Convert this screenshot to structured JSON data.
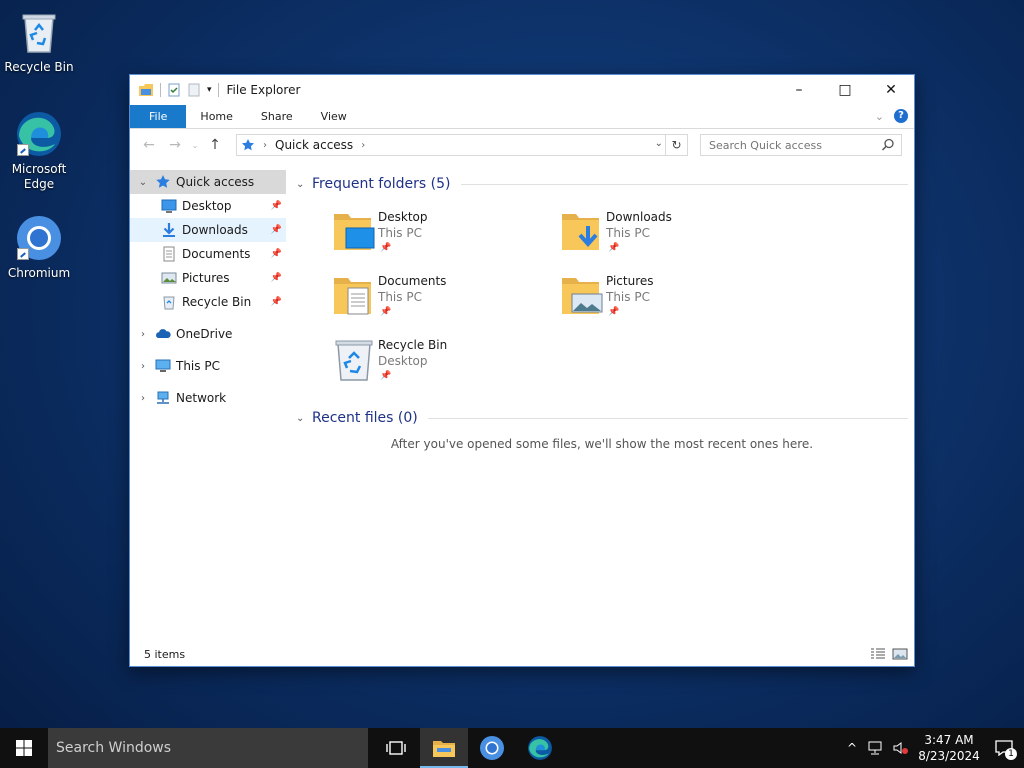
{
  "desktop": {
    "icons": [
      {
        "label": "Recycle Bin"
      },
      {
        "label": "Microsoft Edge"
      },
      {
        "label": "Chromium"
      }
    ]
  },
  "window": {
    "title": "File Explorer",
    "controls": {
      "minimize": "–",
      "maximize": "□",
      "close": "✕"
    },
    "ribbon_tabs": [
      "File",
      "Home",
      "Share",
      "View"
    ],
    "address": {
      "crumb": "Quick access"
    },
    "search": {
      "placeholder": "Search Quick access"
    },
    "nav": {
      "quick_access": "Quick access",
      "quick_items": [
        "Desktop",
        "Downloads",
        "Documents",
        "Pictures",
        "Recycle Bin"
      ],
      "onedrive": "OneDrive",
      "this_pc": "This PC",
      "network": "Network"
    },
    "frequent": {
      "header": "Frequent folders (5)",
      "tiles": [
        {
          "name": "Desktop",
          "sub": "This PC"
        },
        {
          "name": "Downloads",
          "sub": "This PC"
        },
        {
          "name": "Documents",
          "sub": "This PC"
        },
        {
          "name": "Pictures",
          "sub": "This PC"
        },
        {
          "name": "Recycle Bin",
          "sub": "Desktop"
        }
      ]
    },
    "recent": {
      "header": "Recent files (0)",
      "empty": "After you've opened some files, we'll show the most recent ones here."
    },
    "status": "5 items"
  },
  "taskbar": {
    "search_placeholder": "Search Windows",
    "time": "3:47 AM",
    "date": "8/23/2024",
    "notif_count": "1"
  },
  "colors": {
    "accent": "#1979ca",
    "folder": "#f8c75a",
    "desktop_bg": "#0f3670"
  }
}
